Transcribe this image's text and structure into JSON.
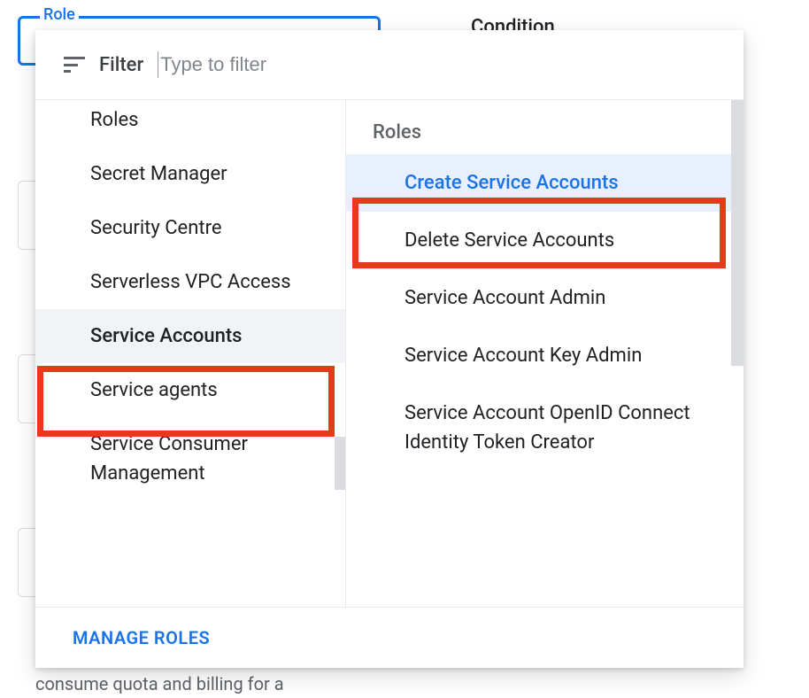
{
  "background": {
    "role_label": "Role",
    "condition_label": "Condition",
    "partial_text": "consume quota and billing for a"
  },
  "filter": {
    "label": "Filter",
    "placeholder": "Type to filter"
  },
  "categories": [
    {
      "label": "Roles",
      "selected": false,
      "cut_off": true
    },
    {
      "label": "Secret Manager",
      "selected": false
    },
    {
      "label": "Security Centre",
      "selected": false
    },
    {
      "label": "Serverless VPC Access",
      "selected": false
    },
    {
      "label": "Service Accounts",
      "selected": true
    },
    {
      "label": "Service agents",
      "selected": false
    },
    {
      "label": "Service Consumer Management",
      "selected": false
    }
  ],
  "roles_panel": {
    "header": "Roles",
    "items": [
      {
        "label": "Create Service Accounts",
        "selected": true
      },
      {
        "label": "Delete Service Accounts",
        "selected": false
      },
      {
        "label": "Service Account Admin",
        "selected": false
      },
      {
        "label": "Service Account Key Admin",
        "selected": false
      },
      {
        "label": "Service Account OpenID Connect Identity Token Creator",
        "selected": false
      }
    ]
  },
  "footer": {
    "manage_roles": "MANAGE ROLES"
  }
}
